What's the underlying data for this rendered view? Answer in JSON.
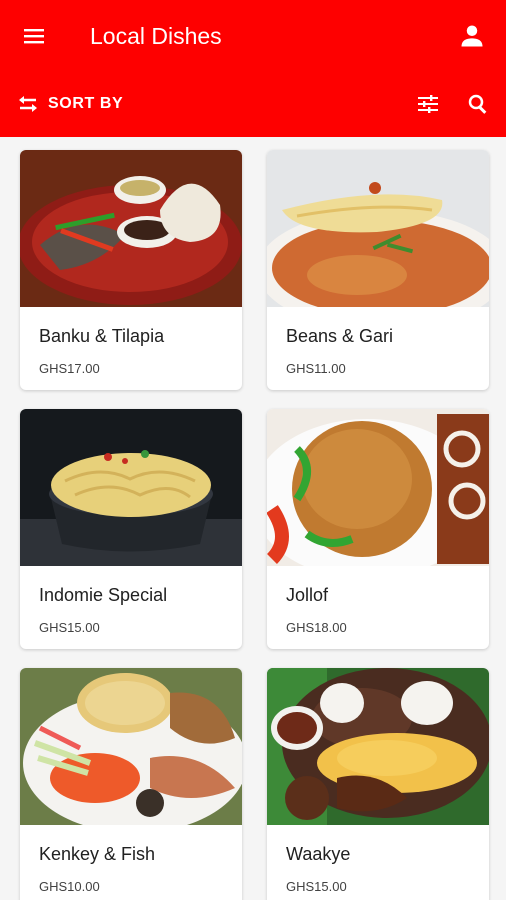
{
  "appbar": {
    "title": "Local Dishes",
    "sort_label": "SORT BY",
    "icons": [
      "menu-icon",
      "account-icon",
      "swap-icon",
      "tune-icon",
      "search-icon"
    ]
  },
  "colors": {
    "primary": "#fe0000",
    "card_bg": "#ffffff",
    "page_bg": "#f5f5f5"
  },
  "dishes": [
    {
      "name": "Banku & Tilapia",
      "price": "GHS17.00"
    },
    {
      "name": "Beans & Gari",
      "price": "GHS11.00"
    },
    {
      "name": "Indomie Special",
      "price": "GHS15.00"
    },
    {
      "name": "Jollof",
      "price": "GHS18.00"
    },
    {
      "name": "Kenkey & Fish",
      "price": "GHS10.00"
    },
    {
      "name": "Waakye",
      "price": "GHS15.00"
    }
  ]
}
